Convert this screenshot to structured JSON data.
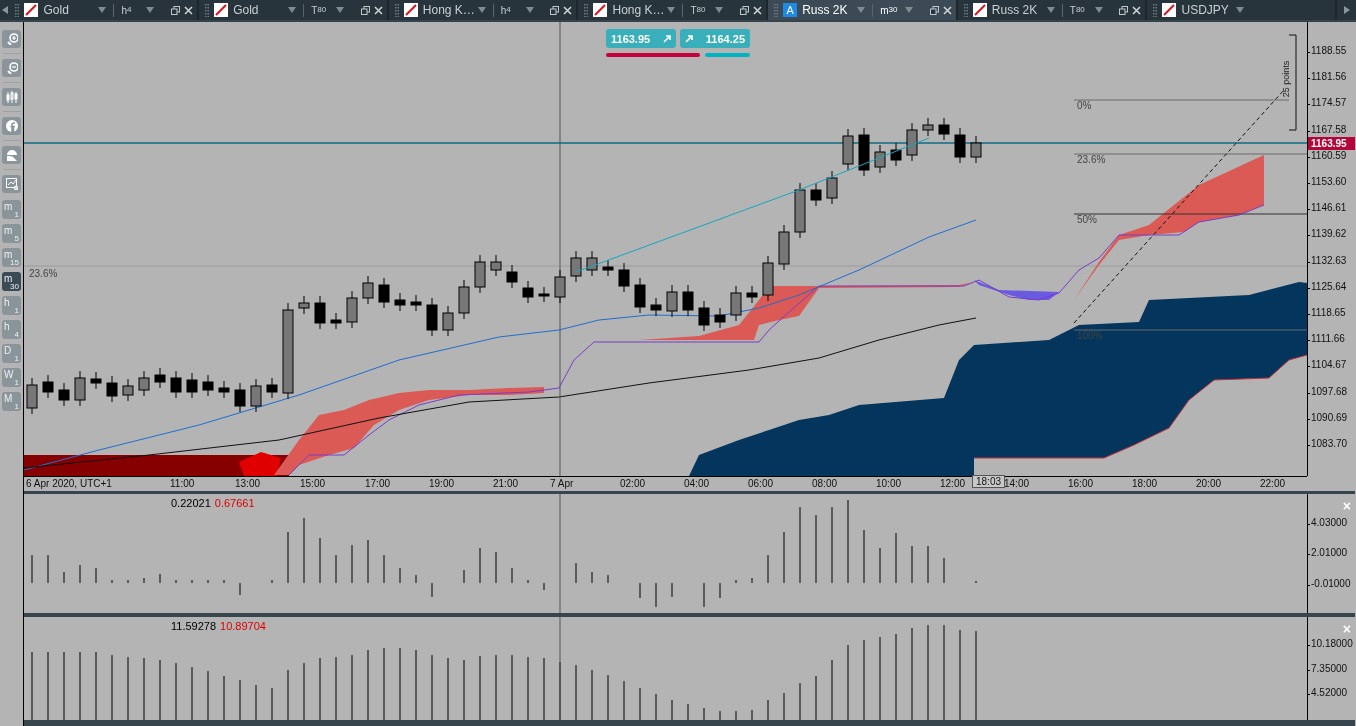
{
  "tabs": [
    {
      "kind": "chart",
      "symbol": "Gold",
      "timeframe": {
        "letter": "h",
        "number": "4"
      },
      "selected": false
    },
    {
      "kind": "chart",
      "symbol": "Gold",
      "timeframe": {
        "letter": "T",
        "number": "80"
      },
      "selected": false
    },
    {
      "kind": "chart",
      "symbol": "Hong K…",
      "timeframe": {
        "letter": "h",
        "number": "4"
      },
      "selected": false
    },
    {
      "kind": "chart",
      "symbol": "Hong K…",
      "timeframe": {
        "letter": "T",
        "number": "80"
      },
      "selected": false
    },
    {
      "kind": "letter",
      "letter": "A",
      "symbol": "Russ 2K",
      "timeframe": {
        "letter": "m",
        "number": "30"
      },
      "selected": true
    },
    {
      "kind": "chart",
      "symbol": "Russ 2K",
      "timeframe": {
        "letter": "T",
        "number": "80"
      },
      "selected": false
    },
    {
      "kind": "chart",
      "symbol": "USDJPY",
      "selected": false
    }
  ],
  "toolbar": {
    "timeframes": [
      {
        "letter": "m",
        "number": "1",
        "selected": false
      },
      {
        "letter": "m",
        "number": "5",
        "selected": false
      },
      {
        "letter": "m",
        "number": "15",
        "selected": false
      },
      {
        "letter": "m",
        "number": "30",
        "selected": true
      },
      {
        "letter": "h",
        "number": "1",
        "selected": false
      },
      {
        "letter": "h",
        "number": "4",
        "selected": false
      },
      {
        "letter": "D",
        "number": "1",
        "selected": false
      },
      {
        "letter": "W",
        "number": "1",
        "selected": false
      },
      {
        "letter": "M",
        "number": "1",
        "selected": false
      }
    ]
  },
  "main_chart": {
    "trade_buttons": [
      {
        "kind": "sell",
        "price": "1163.95"
      },
      {
        "kind": "buy",
        "price": "1164.25"
      }
    ],
    "fib_labels": [
      "0%",
      "23.6%",
      "50%",
      "100%"
    ],
    "left_level_label": "23.6%",
    "measure_label": "25 points",
    "price_axis": [
      "1188.55",
      "1181.56",
      "1174.57",
      "1167.58",
      "1160.59",
      "1153.60",
      "1146.61",
      "1139.62",
      "1132.63",
      "1125.64",
      "1118.65",
      "1111.66",
      "1104.67",
      "1097.68",
      "1090.69",
      "1083.70"
    ],
    "current_price": "1163.95",
    "time_axis": [
      "6 Apr 2020, UTC+1",
      "11:00",
      "13:00",
      "15:00",
      "17:00",
      "19:00",
      "21:00",
      "7 Apr",
      "02:00",
      "04:00",
      "06:00",
      "08:00",
      "10:00",
      "12:00",
      "14:00",
      "16:00",
      "18:00",
      "20:00",
      "22:00"
    ],
    "cursor_time": "18:03"
  },
  "indicators": [
    {
      "values": [
        {
          "text": "0.22021",
          "color": "#000000"
        },
        {
          "text": "0.67661",
          "color": "#e00000"
        }
      ],
      "axis": [
        "4.03000",
        "2.01000",
        "-0.01000"
      ],
      "close": "×"
    },
    {
      "values": [
        {
          "text": "11.59278",
          "color": "#000000"
        },
        {
          "text": "10.89704",
          "color": "#e00000"
        }
      ],
      "axis": [
        "10.18000",
        "7.35000",
        "4.52000"
      ],
      "close": "×"
    }
  ]
}
